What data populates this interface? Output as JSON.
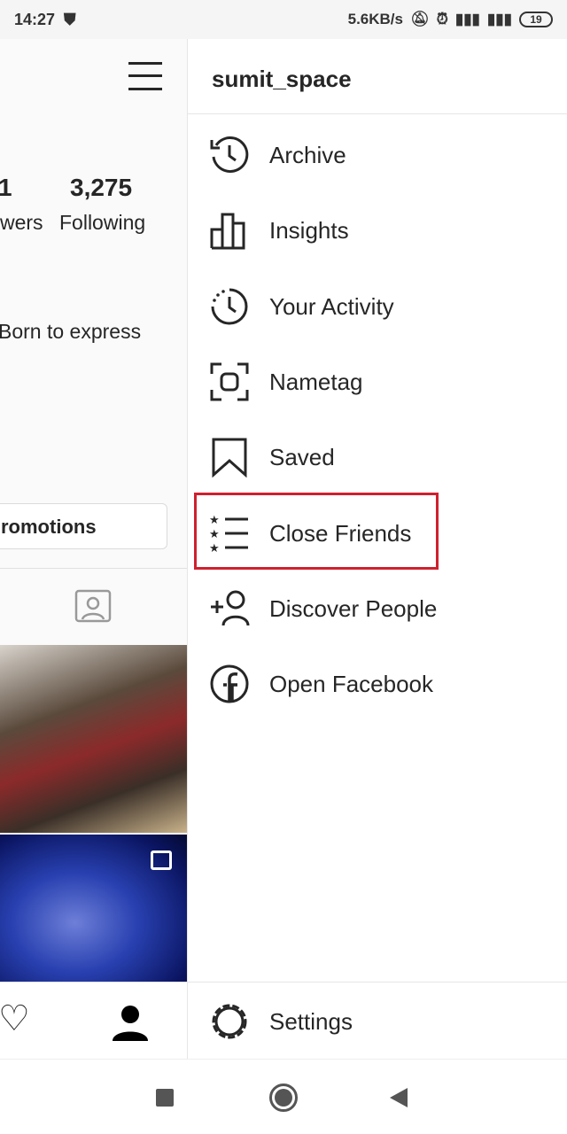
{
  "status_bar": {
    "time": "14:27",
    "speed": "5.6KB/s",
    "battery": "19"
  },
  "profile": {
    "followers_partial": "1",
    "followers_label_partial": "wers",
    "following_count": "3,275",
    "following_label": "Following",
    "bio_partial": "Born to express",
    "promotions_partial": "romotions"
  },
  "drawer": {
    "username": "sumit_space",
    "items": [
      {
        "label": "Archive",
        "icon": "archive-icon"
      },
      {
        "label": "Insights",
        "icon": "insights-icon"
      },
      {
        "label": "Your Activity",
        "icon": "activity-icon"
      },
      {
        "label": "Nametag",
        "icon": "nametag-icon"
      },
      {
        "label": "Saved",
        "icon": "bookmark-icon"
      },
      {
        "label": "Close Friends",
        "icon": "close-friends-icon",
        "highlighted": true
      },
      {
        "label": "Discover People",
        "icon": "add-person-icon"
      },
      {
        "label": "Open Facebook",
        "icon": "facebook-icon"
      }
    ],
    "settings": "Settings",
    "highlight_color": "#d0202e"
  }
}
